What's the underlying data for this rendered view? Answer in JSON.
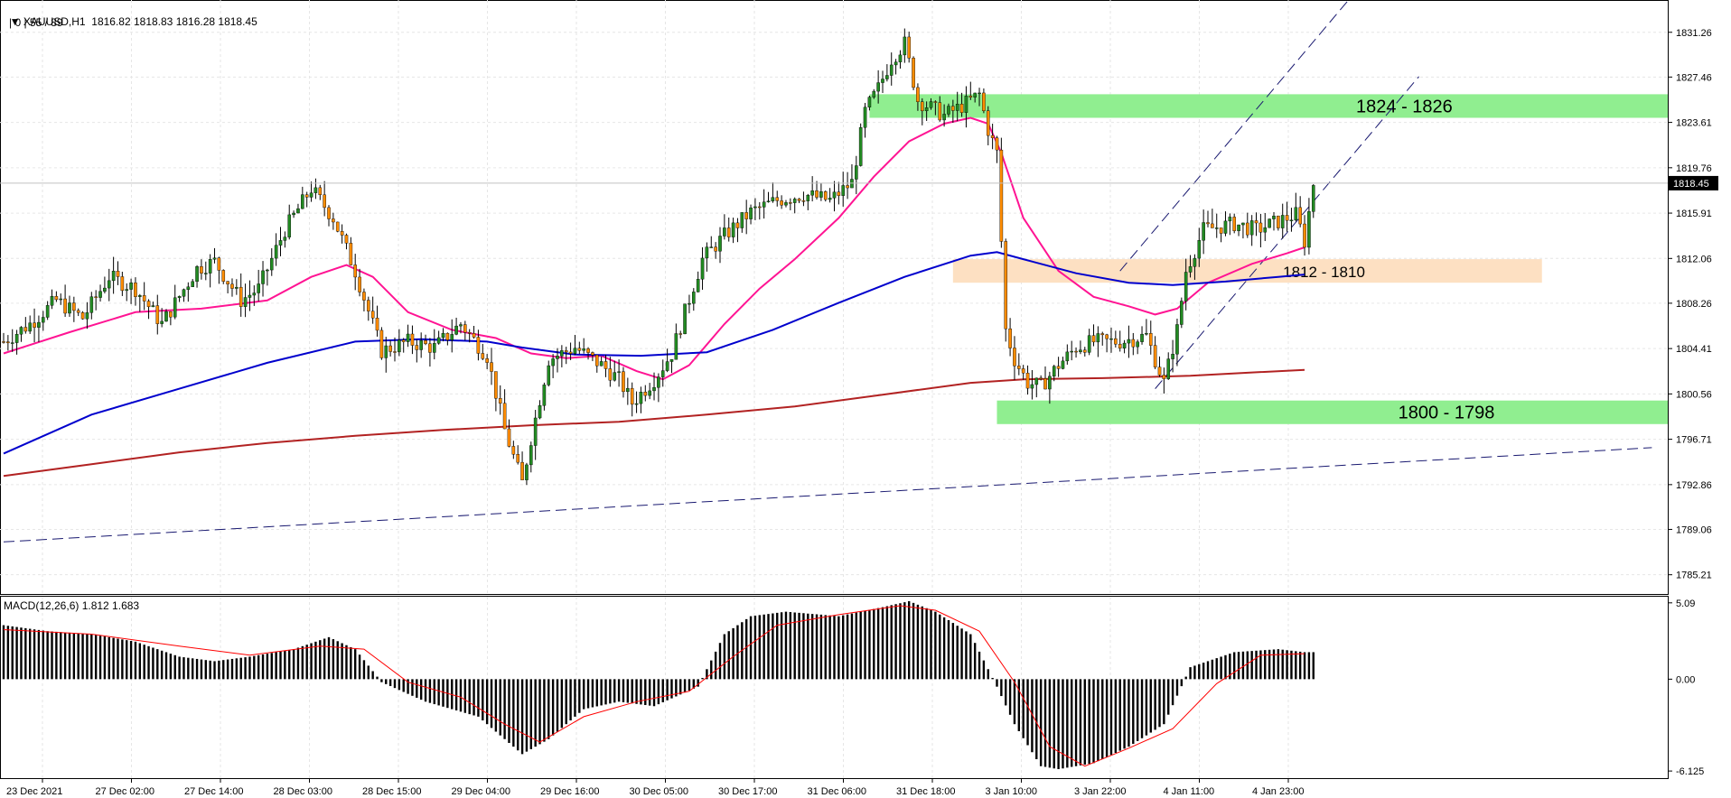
{
  "header": {
    "symbol": "XAUUSD,H1",
    "ohlc": "1816.82 1818.83 1816.28 1818.45",
    "ma_line": "| 0 | 55 / 89"
  },
  "price_axis": {
    "ticks": [
      "1831.26",
      "1827.46",
      "1823.61",
      "1819.76",
      "1815.91",
      "1812.06",
      "1808.26",
      "1804.41",
      "1800.56",
      "1796.71",
      "1792.86",
      "1789.06",
      "1785.21"
    ],
    "current_price": "1818.45"
  },
  "macd_axis": {
    "ticks": [
      "5.09",
      "0.00",
      "-6.125"
    ]
  },
  "macd_label": "MACD(12,26,6) 1.812 1.683",
  "time_axis": [
    "23 Dec 2021",
    "27 Dec 02:00",
    "27 Dec 14:00",
    "28 Dec 03:00",
    "28 Dec 15:00",
    "29 Dec 04:00",
    "29 Dec 16:00",
    "30 Dec 05:00",
    "30 Dec 17:00",
    "31 Dec 06:00",
    "31 Dec 18:00",
    "3 Jan 10:00",
    "3 Jan 22:00",
    "4 Jan 11:00",
    "4 Jan 23:00"
  ],
  "zones": [
    {
      "label": "1824 - 1826",
      "low": 1824,
      "high": 1826,
      "color": "#90ee90"
    },
    {
      "label": "1812 - 1810",
      "low": 1810,
      "high": 1812,
      "color": "#fde0c2"
    },
    {
      "label": "1800 - 1798",
      "low": 1798,
      "high": 1800,
      "color": "#90ee90"
    }
  ],
  "colors": {
    "bull": "#228b22",
    "bear": "#ff8c00",
    "wick": "#000000",
    "ma_fast": "#ff1493",
    "ma_mid": "#0000cd",
    "ma_slow": "#b22222",
    "trend": "#191970",
    "grid": "#e6e6e6",
    "axis": "#000000",
    "price_tag_bg": "#000000",
    "price_tag_fg": "#ffffff"
  },
  "chart_data": {
    "type": "candlestick",
    "title": "XAUUSD,H1",
    "timeframe": "H1",
    "ylim": [
      1783.5,
      1834.0
    ],
    "macd_ylim": [
      -6.6,
      5.5
    ],
    "close_path": [
      [
        0,
        1805
      ],
      [
        6,
        1806.5
      ],
      [
        12,
        1808.5
      ],
      [
        18,
        1807
      ],
      [
        24,
        1810.5
      ],
      [
        30,
        1809.5
      ],
      [
        36,
        1806.5
      ],
      [
        44,
        1811.2
      ],
      [
        48,
        1811.8
      ],
      [
        54,
        1808.5
      ],
      [
        58,
        1809.5
      ],
      [
        64,
        1814.5
      ],
      [
        70,
        1818
      ],
      [
        75,
        1815.5
      ],
      [
        80,
        1811
      ],
      [
        86,
        1804.2
      ],
      [
        92,
        1805
      ],
      [
        98,
        1804.5
      ],
      [
        104,
        1806.5
      ],
      [
        110,
        1803.8
      ],
      [
        114,
        1797.5
      ],
      [
        118,
        1793
      ],
      [
        120,
        1796.8
      ],
      [
        124,
        1803.5
      ],
      [
        130,
        1804.5
      ],
      [
        136,
        1803
      ],
      [
        140,
        1801.8
      ],
      [
        143,
        1799.8
      ],
      [
        148,
        1801.8
      ],
      [
        152,
        1804
      ],
      [
        155,
        1807.5
      ],
      [
        159,
        1812
      ],
      [
        164,
        1814
      ],
      [
        170,
        1816
      ],
      [
        176,
        1817
      ],
      [
        182,
        1817.5
      ],
      [
        188,
        1817
      ],
      [
        193,
        1818.5
      ],
      [
        196,
        1824.5
      ],
      [
        199,
        1826.5
      ],
      [
        202,
        1829
      ],
      [
        205,
        1830.3
      ],
      [
        208,
        1825.5
      ],
      [
        214,
        1824.2
      ],
      [
        218,
        1825
      ],
      [
        222,
        1826
      ],
      [
        224,
        1823
      ],
      [
        226,
        1821
      ],
      [
        228,
        1806
      ],
      [
        230,
        1803.5
      ],
      [
        233,
        1801.5
      ],
      [
        236,
        1801.2
      ],
      [
        240,
        1803
      ],
      [
        244,
        1804.5
      ],
      [
        248,
        1805
      ],
      [
        254,
        1805
      ],
      [
        260,
        1805.5
      ],
      [
        264,
        1801.5
      ],
      [
        267,
        1806
      ],
      [
        269,
        1811
      ],
      [
        273,
        1814.5
      ],
      [
        280,
        1815
      ],
      [
        285,
        1814.5
      ],
      [
        290,
        1815.2
      ],
      [
        294,
        1815.8
      ],
      [
        296,
        1813.5
      ],
      [
        298,
        1818.45
      ]
    ],
    "moving_averages": [
      {
        "color": "#ff1493",
        "points": [
          [
            0,
            1804
          ],
          [
            15,
            1805.8
          ],
          [
            30,
            1807.5
          ],
          [
            45,
            1807.8
          ],
          [
            60,
            1808.5
          ],
          [
            70,
            1810.5
          ],
          [
            78,
            1811.5
          ],
          [
            84,
            1810.5
          ],
          [
            92,
            1807.5
          ],
          [
            102,
            1806
          ],
          [
            112,
            1805.3
          ],
          [
            120,
            1804
          ],
          [
            128,
            1803.6
          ],
          [
            136,
            1803.8
          ],
          [
            144,
            1802.5
          ],
          [
            150,
            1801.8
          ],
          [
            156,
            1803
          ],
          [
            164,
            1806.5
          ],
          [
            172,
            1809.5
          ],
          [
            180,
            1812
          ],
          [
            190,
            1815.5
          ],
          [
            198,
            1819
          ],
          [
            206,
            1822
          ],
          [
            214,
            1823.5
          ],
          [
            220,
            1824
          ],
          [
            224,
            1823.5
          ],
          [
            227,
            1821
          ],
          [
            232,
            1815.5
          ],
          [
            240,
            1811
          ],
          [
            248,
            1808.8
          ],
          [
            256,
            1808
          ],
          [
            262,
            1807.3
          ],
          [
            267,
            1807.8
          ],
          [
            274,
            1810
          ],
          [
            284,
            1811.6
          ],
          [
            292,
            1812.5
          ],
          [
            296,
            1813
          ]
        ]
      },
      {
        "color": "#0000cd",
        "points": [
          [
            0,
            1795.5
          ],
          [
            20,
            1798.8
          ],
          [
            40,
            1801
          ],
          [
            60,
            1803.2
          ],
          [
            80,
            1805
          ],
          [
            95,
            1805.2
          ],
          [
            110,
            1805
          ],
          [
            118,
            1804.5
          ],
          [
            130,
            1803.9
          ],
          [
            145,
            1803.8
          ],
          [
            160,
            1804.1
          ],
          [
            175,
            1806
          ],
          [
            190,
            1808.3
          ],
          [
            205,
            1810.5
          ],
          [
            220,
            1812.3
          ],
          [
            226,
            1812.6
          ],
          [
            232,
            1812
          ],
          [
            244,
            1810.8
          ],
          [
            256,
            1810
          ],
          [
            266,
            1809.8
          ],
          [
            278,
            1810.1
          ],
          [
            290,
            1810.5
          ],
          [
            296,
            1810.7
          ]
        ]
      },
      {
        "color": "#b22222",
        "points": [
          [
            0,
            1793.6
          ],
          [
            20,
            1794.6
          ],
          [
            40,
            1795.6
          ],
          [
            60,
            1796.4
          ],
          [
            80,
            1797
          ],
          [
            100,
            1797.5
          ],
          [
            120,
            1797.9
          ],
          [
            140,
            1798.2
          ],
          [
            160,
            1798.8
          ],
          [
            180,
            1799.5
          ],
          [
            200,
            1800.5
          ],
          [
            220,
            1801.5
          ],
          [
            232,
            1801.8
          ],
          [
            250,
            1801.9
          ],
          [
            270,
            1802.1
          ],
          [
            285,
            1802.4
          ],
          [
            296,
            1802.6
          ]
        ]
      }
    ],
    "zones": [
      {
        "label": "1824 - 1826",
        "x_start": 197,
        "low": 1824,
        "high": 1826
      },
      {
        "label": "1812 - 1810",
        "x_start": 216,
        "x_end": 350,
        "low": 1810,
        "high": 1812
      },
      {
        "label": "1800 - 1798",
        "x_start": 226,
        "low": 1798,
        "high": 1800
      }
    ],
    "trendlines": [
      {
        "style": "dashed",
        "p1": [
          0,
          1788
        ],
        "p2": [
          375,
          1796
        ]
      },
      {
        "style": "dashed",
        "p1": [
          113,
          1790
        ],
        "p2": [
          113,
          1790
        ]
      },
      {
        "style": "dashed",
        "p1": [
          262,
          1801
        ],
        "p2": [
          322,
          1827.5
        ]
      },
      {
        "style": "dashed",
        "p1": [
          254,
          1811
        ],
        "p2": [
          306,
          1834
        ]
      }
    ],
    "macd": {
      "label": "MACD(12,26,6) 1.812 1.683",
      "histogram_path": [
        [
          0,
          3.6
        ],
        [
          10,
          3.2
        ],
        [
          20,
          3.0
        ],
        [
          30,
          2.5
        ],
        [
          40,
          1.5
        ],
        [
          48,
          1.2
        ],
        [
          56,
          1.5
        ],
        [
          66,
          2.0
        ],
        [
          74,
          2.8
        ],
        [
          80,
          2.0
        ],
        [
          86,
          -0.2
        ],
        [
          96,
          -1.5
        ],
        [
          108,
          -2.5
        ],
        [
          118,
          -5.0
        ],
        [
          124,
          -4.0
        ],
        [
          132,
          -2.0
        ],
        [
          140,
          -1.5
        ],
        [
          148,
          -1.8
        ],
        [
          158,
          -0.5
        ],
        [
          164,
          3.0
        ],
        [
          170,
          4.2
        ],
        [
          178,
          4.5
        ],
        [
          190,
          4.2
        ],
        [
          200,
          4.8
        ],
        [
          206,
          5.2
        ],
        [
          212,
          4.5
        ],
        [
          220,
          3.0
        ],
        [
          226,
          -0.5
        ],
        [
          230,
          -3.0
        ],
        [
          236,
          -5.8
        ],
        [
          240,
          -6.0
        ],
        [
          248,
          -5.6
        ],
        [
          256,
          -4.5
        ],
        [
          264,
          -3.0
        ],
        [
          270,
          0.8
        ],
        [
          280,
          1.8
        ],
        [
          290,
          2.0
        ],
        [
          296,
          1.8
        ]
      ],
      "signal_path": [
        [
          0,
          3.3
        ],
        [
          20,
          3.0
        ],
        [
          40,
          2.2
        ],
        [
          56,
          1.6
        ],
        [
          72,
          2.2
        ],
        [
          82,
          2.0
        ],
        [
          92,
          -0.2
        ],
        [
          104,
          -1.2
        ],
        [
          114,
          -3.0
        ],
        [
          122,
          -4.2
        ],
        [
          132,
          -2.5
        ],
        [
          144,
          -1.5
        ],
        [
          156,
          -0.8
        ],
        [
          166,
          1.5
        ],
        [
          176,
          3.6
        ],
        [
          190,
          4.3
        ],
        [
          204,
          4.9
        ],
        [
          212,
          4.6
        ],
        [
          222,
          3.2
        ],
        [
          230,
          -0.2
        ],
        [
          238,
          -4.5
        ],
        [
          246,
          -5.8
        ],
        [
          256,
          -4.6
        ],
        [
          266,
          -3.3
        ],
        [
          276,
          -0.3
        ],
        [
          286,
          1.6
        ],
        [
          296,
          1.7
        ]
      ]
    }
  }
}
